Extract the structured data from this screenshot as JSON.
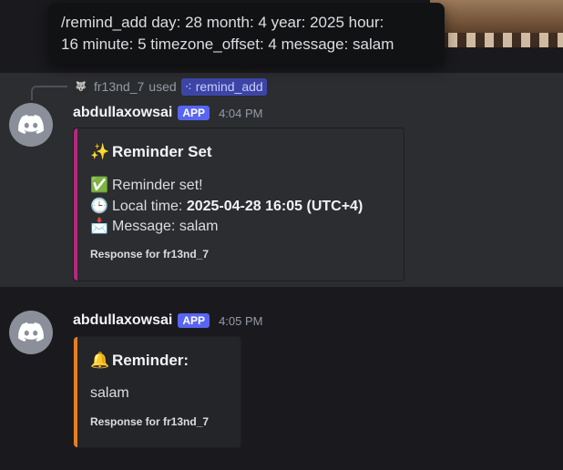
{
  "tooltip": {
    "line1": "/remind_add day: 28 month: 4 year: 2025 hour:",
    "line2": "16 minute: 5 timezone_offset: 4 message: salam"
  },
  "reply": {
    "user": "fr13nd_7",
    "used_text": "used",
    "command": "remind_add"
  },
  "messages": [
    {
      "author": "abdullaxowsai",
      "badge": "APP",
      "time": "4:04 PM",
      "embed": {
        "accent": "#b5287b",
        "title_emoji": "✨",
        "title": "Reminder Set",
        "line1_emoji": "✅",
        "line1": "Reminder set!",
        "line2_emoji": "🕒",
        "line2_label": "Local time:",
        "line2_value": "2025-04-28 16:05 (UTC+4)",
        "line3_emoji": "📩",
        "line3": "Message: salam",
        "footer": "Response for fr13nd_7"
      }
    },
    {
      "author": "abdullaxowsai",
      "badge": "APP",
      "time": "4:05 PM",
      "embed": {
        "accent": "#e67e22",
        "title_emoji": "🔔",
        "title": "Reminder:",
        "body": "salam",
        "footer": "Response for fr13nd_7"
      }
    }
  ]
}
